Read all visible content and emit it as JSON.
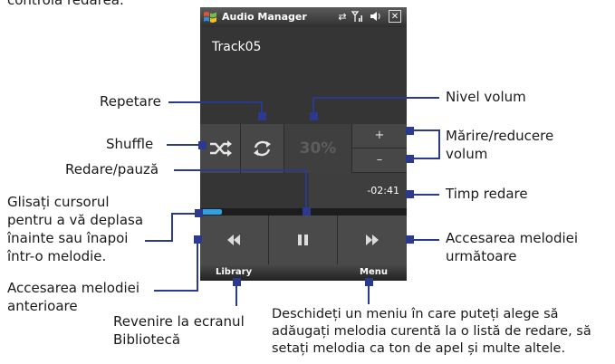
{
  "top_caption": "controla redarea.",
  "app": {
    "title": "Audio Manager",
    "track_name": "Track05",
    "volume_percent": "30%",
    "volume_up_label": "+",
    "volume_down_label": "–",
    "time_remaining": "-02:41",
    "progress_fraction": 0.1,
    "softkey_left": "Library",
    "softkey_right": "Menu",
    "close_glyph": "✕"
  },
  "callouts": {
    "repeat": "Repetare",
    "volume_level": "Nivel volum",
    "shuffle": "Shuffle",
    "volume_adjust": "Mărire/reducere volum",
    "play_pause": "Redare/pauză",
    "play_time": "Timp redare",
    "seek": "Glisați cursorul pentru a vă deplasa înainte sau înapoi într-o melodie.",
    "next": "Accesarea melodiei următoare",
    "previous": "Accesarea melodiei anterioare",
    "library": "Revenire la ecranul Bibliotecă",
    "menu": "Deschideți un meniu în care puteți alege să adăugați melodia curentă la o listă de redare, să setați melodia ca ton de apel și multe altele."
  },
  "icons": [
    "windows-logo-icon",
    "connectivity-icon",
    "signal-icon",
    "speaker-icon",
    "close-icon",
    "shuffle-icon",
    "repeat-icon",
    "previous-icon",
    "pause-icon",
    "next-icon"
  ],
  "colors": {
    "callout_line": "#2b3a8f",
    "seek_fill": "#2da0e6"
  }
}
